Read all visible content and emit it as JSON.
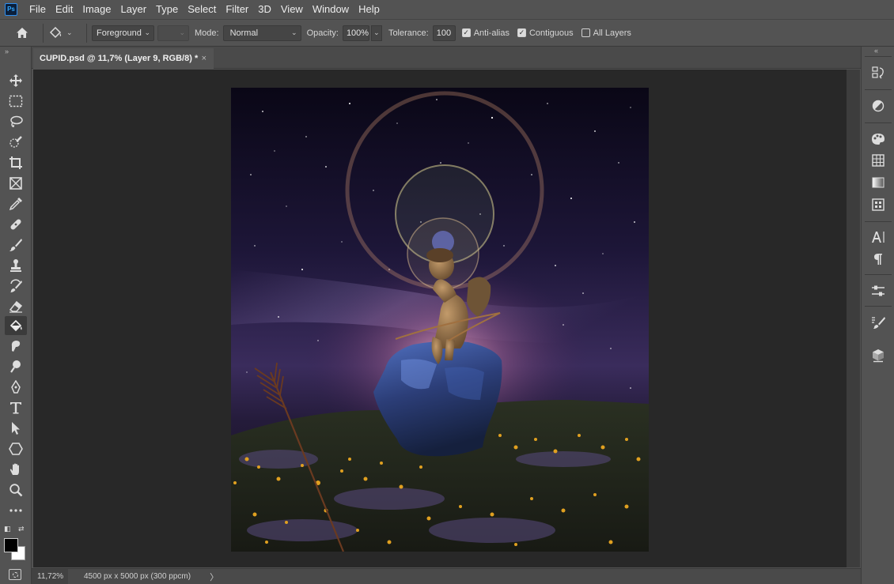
{
  "app": {
    "logo": "Ps"
  },
  "menu": [
    "File",
    "Edit",
    "Image",
    "Layer",
    "Type",
    "Select",
    "Filter",
    "3D",
    "View",
    "Window",
    "Help"
  ],
  "options": {
    "fill_source": "Foreground",
    "mode_label": "Mode:",
    "mode_value": "Normal",
    "opacity_label": "Opacity:",
    "opacity_value": "100%",
    "tolerance_label": "Tolerance:",
    "tolerance_value": "100",
    "anti_alias_label": "Anti-alias",
    "anti_alias_checked": true,
    "contiguous_label": "Contiguous",
    "contiguous_checked": true,
    "all_layers_label": "All Layers",
    "all_layers_checked": false
  },
  "document": {
    "tab_title": "CUPID.psd @ 11,7% (Layer 9, RGB/8) *",
    "close_glyph": "×"
  },
  "status": {
    "zoom": "11,72%",
    "doc_info": "4500 px x 5000 px (300 ppcm)",
    "arrow": "〉"
  },
  "tools": [
    {
      "name": "move-tool",
      "icon": "move-icon",
      "active": false
    },
    {
      "name": "rectangular-marquee-tool",
      "icon": "marquee-icon",
      "active": false
    },
    {
      "name": "lasso-tool",
      "icon": "lasso-icon",
      "active": false
    },
    {
      "name": "quick-selection-tool",
      "icon": "quick-selection-icon",
      "active": false
    },
    {
      "name": "crop-tool",
      "icon": "crop-icon",
      "active": false
    },
    {
      "name": "frame-tool",
      "icon": "frame-icon",
      "active": false
    },
    {
      "name": "eyedropper-tool",
      "icon": "eyedropper-icon",
      "active": false
    },
    {
      "name": "healing-brush-tool",
      "icon": "bandage-icon",
      "active": false
    },
    {
      "name": "brush-tool",
      "icon": "brush-icon",
      "active": false
    },
    {
      "name": "clone-stamp-tool",
      "icon": "stamp-icon",
      "active": false
    },
    {
      "name": "history-brush-tool",
      "icon": "history-brush-icon",
      "active": false
    },
    {
      "name": "eraser-tool",
      "icon": "eraser-icon",
      "active": false
    },
    {
      "name": "paint-bucket-tool",
      "icon": "paint-bucket-icon",
      "active": true
    },
    {
      "name": "smudge-tool",
      "icon": "smudge-icon",
      "active": false
    },
    {
      "name": "dodge-tool",
      "icon": "dodge-icon",
      "active": false
    },
    {
      "name": "pen-tool",
      "icon": "pen-icon",
      "active": false
    },
    {
      "name": "type-tool",
      "icon": "type-icon",
      "active": false
    },
    {
      "name": "path-selection-tool",
      "icon": "arrow-icon",
      "active": false
    },
    {
      "name": "shape-tool",
      "icon": "polygon-icon",
      "active": false
    },
    {
      "name": "hand-tool",
      "icon": "hand-icon",
      "active": false
    },
    {
      "name": "zoom-tool",
      "icon": "magnifier-icon",
      "active": false
    },
    {
      "name": "more-tools",
      "icon": "ellipsis-icon",
      "active": false
    }
  ],
  "right_panels": [
    "history-icon",
    "adjustments-icon",
    "swatches-icon",
    "grid-icon",
    "gradient-icon",
    "patterns-icon",
    "character-icon",
    "paragraph-icon",
    "properties-icon",
    "brush-settings-icon",
    "layers-3d-icon"
  ],
  "colors": {
    "foreground": "#000000",
    "background": "#ffffff",
    "canvas_bg": "#282828",
    "ui": "#535353"
  }
}
